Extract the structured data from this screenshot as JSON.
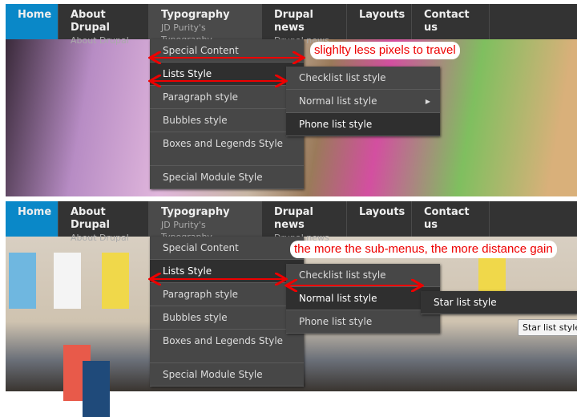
{
  "nav": [
    {
      "title": "Home",
      "sub": ""
    },
    {
      "title": "About Drupal",
      "sub": "About Drupal"
    },
    {
      "title": "Typography",
      "sub": "JD Purity's Typography"
    },
    {
      "title": "Drupal news",
      "sub": "Drupal news"
    },
    {
      "title": "Layouts",
      "sub": ""
    },
    {
      "title": "Contact us",
      "sub": ""
    }
  ],
  "dropdown": [
    "Special Content",
    "Lists Style",
    "Paragraph style",
    "Bubbles style",
    "Boxes and Legends Style",
    "Special Module Style"
  ],
  "lists_submenu": [
    "Checklist list style",
    "Normal list style",
    "Phone list style"
  ],
  "normal_submenu": [
    "Star list style"
  ],
  "tooltip": "Star list style",
  "annotations": {
    "top": "slighlty less pixels to travel",
    "bottom": "the more the sub-menus, the more distance gain"
  },
  "colors": {
    "accent": "#0a88c8",
    "annotation": "#ee0000"
  }
}
